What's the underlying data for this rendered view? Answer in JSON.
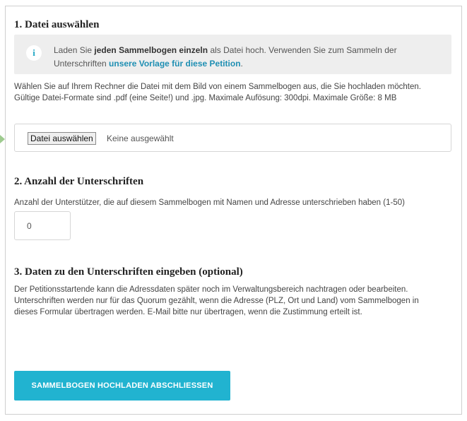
{
  "section1": {
    "title": "1. Datei auswählen",
    "info": {
      "icon": "info-icon",
      "icon_glyph": "i",
      "text_before": "Laden Sie ",
      "text_bold": "jeden Sammelbogen einzeln",
      "text_middle": " als Datei hoch. Verwenden Sie zum Sammeln der Unterschriften ",
      "link": "unsere Vorlage für diese Petition",
      "text_after": "."
    },
    "description": "Wählen Sie auf Ihrem Rechner die Datei mit dem Bild von einem Sammelbogen aus, die Sie hochladen möchten. Gültige Datei-Formate sind .pdf (eine Seite!) und .jpg. Maximale Aufösung: 300dpi. Maximale Größe: 8 MB",
    "file_button": "Datei auswählen",
    "file_status": "Keine ausgewählt"
  },
  "section2": {
    "title": "2. Anzahl der Unterschriften",
    "description": "Anzahl der Unterstützer, die auf diesem Sammelbogen mit Namen und Adresse unterschrieben haben (1-50)",
    "value": "0"
  },
  "section3": {
    "title": "3. Daten zu den Unterschriften eingeben (optional)",
    "line1": "Der Petitionsstartende kann die Adressdaten später noch im Verwaltungsbereich nachtragen oder bearbeiten.",
    "line2": "Unterschriften werden nur für das Quorum gezählt, wenn die Adresse (PLZ, Ort und Land) vom Sammelbogen in dieses Formular übertragen werden. E-Mail bitte nur übertragen, wenn die Zustimmung erteilt ist."
  },
  "submit_label": "SAMMELBOGEN HOCHLADEN ABSCHLIESSEN",
  "colors": {
    "accent": "#21b3d0",
    "link": "#1f8fb3",
    "info_bg": "#eeeeee",
    "side_arrow": "#9ecb8f"
  }
}
